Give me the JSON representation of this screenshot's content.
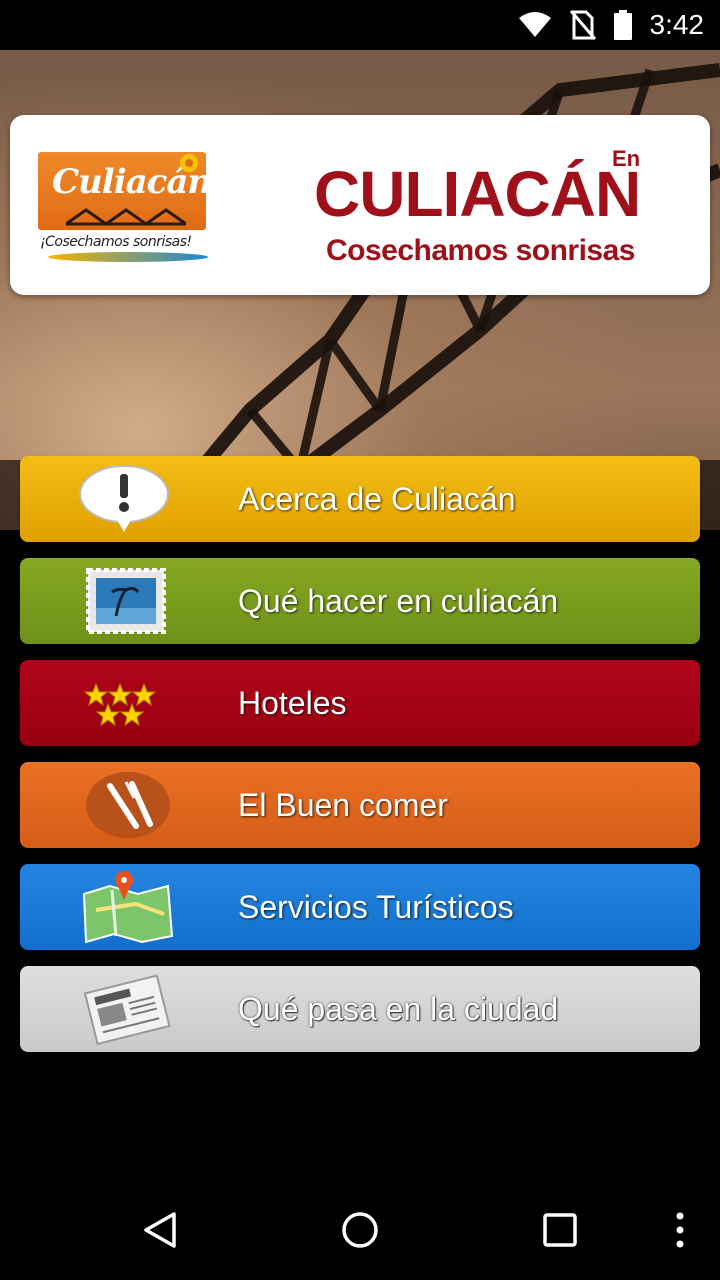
{
  "status_bar": {
    "time": "3:42",
    "icons": [
      "wifi-icon",
      "no-sim-icon",
      "battery-icon"
    ]
  },
  "header": {
    "logo": {
      "word": "Culiacán",
      "tagline": "¡Cosechamos sonrisas!"
    },
    "brand": {
      "prefix": "En",
      "title": "CULIACÁN",
      "subtitle": "Cosechamos sonrisas"
    }
  },
  "menu": [
    {
      "label": "Acerca de Culiacán",
      "icon": "info-bubble-icon",
      "color": "#f0b400"
    },
    {
      "label": "Qué hacer en culiacán",
      "icon": "postcard-stamp-icon",
      "color": "#7b9e1e"
    },
    {
      "label": "Hoteles",
      "icon": "stars-icon",
      "color": "#a00214"
    },
    {
      "label": "El Buen comer",
      "icon": "fork-knife-icon",
      "color": "#e0661e"
    },
    {
      "label": "Servicios Turísticos",
      "icon": "map-pin-icon",
      "color": "#1a7ad6"
    },
    {
      "label": "Qué pasa en la ciudad",
      "icon": "newspaper-icon",
      "color": "#d4d4d4"
    }
  ],
  "nav_bar": {
    "buttons": [
      "back-icon",
      "home-icon",
      "recents-icon",
      "overflow-menu-icon"
    ]
  }
}
